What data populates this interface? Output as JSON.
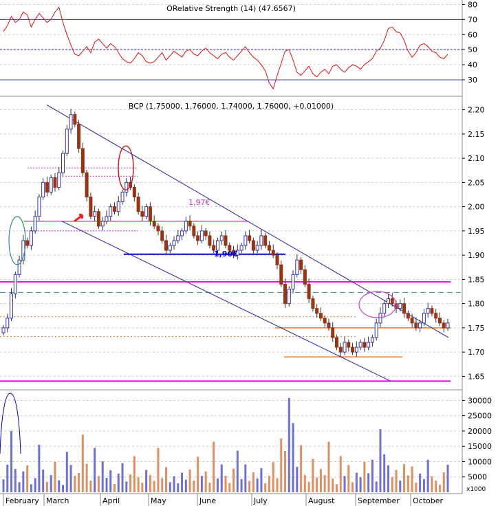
{
  "chart_data": [
    {
      "type": "line",
      "title": "ORelative Strength (14) (47.6567)",
      "ylim": [
        20,
        82
      ],
      "y_ticks": [
        "80",
        "70",
        "60",
        "50",
        "40",
        "30"
      ],
      "y_tick_values": [
        80,
        70,
        60,
        50,
        40,
        30
      ],
      "reference_lines": [
        70,
        50,
        30
      ],
      "grid": true,
      "series": [
        {
          "values": [
            62,
            66,
            72,
            68,
            70,
            75,
            73,
            65,
            70,
            74,
            71,
            68,
            70,
            75,
            78,
            68,
            60,
            53,
            47,
            46,
            49,
            52,
            48,
            55,
            57,
            54,
            51,
            54,
            52,
            48,
            44,
            42,
            41,
            44,
            48,
            46,
            42,
            41,
            42,
            45,
            48,
            43,
            46,
            49,
            47,
            45,
            49,
            50,
            47,
            46,
            49,
            51,
            48,
            46,
            44,
            47,
            48,
            45,
            43,
            46,
            49,
            52,
            48,
            45,
            43,
            40,
            36,
            28,
            24,
            33,
            41,
            49,
            50,
            43,
            35,
            33,
            36,
            39,
            34,
            32,
            35,
            37,
            34,
            39,
            40,
            37,
            35,
            38,
            40,
            39,
            37,
            40,
            42,
            44,
            49,
            51,
            56,
            64,
            65,
            62,
            61,
            56,
            49,
            45,
            48,
            53,
            54,
            52,
            49,
            48,
            45,
            44,
            47
          ]
        }
      ]
    },
    {
      "type": "candlestick",
      "title": "BCP (1.75000, 1.76000, 1.74000, 1.76000, +0.01000)",
      "ylim": [
        1.625,
        2.225
      ],
      "y_ticks": [
        "2.20",
        "2.15",
        "2.10",
        "2.05",
        "2.00",
        "1.95",
        "1.90",
        "1.85",
        "1.80",
        "1.75",
        "1.70",
        "1.65"
      ],
      "y_tick_values": [
        2.2,
        2.15,
        2.1,
        2.05,
        2.0,
        1.95,
        1.9,
        1.85,
        1.8,
        1.75,
        1.7,
        1.65
      ],
      "grid": true,
      "close": [
        1.75,
        1.77,
        1.82,
        1.86,
        1.89,
        1.93,
        1.92,
        1.95,
        1.98,
        2.02,
        2.05,
        2.03,
        2.06,
        2.04,
        2.07,
        2.11,
        2.16,
        2.19,
        2.17,
        2.12,
        2.07,
        2.02,
        1.98,
        1.99,
        1.96,
        1.97,
        1.98,
        2.0,
        1.99,
        2.01,
        2.03,
        2.05,
        2.04,
        2.02,
        1.99,
        1.98,
        2.0,
        1.97,
        1.96,
        1.95,
        1.93,
        1.91,
        1.92,
        1.93,
        1.94,
        1.95,
        1.97,
        1.96,
        1.94,
        1.93,
        1.95,
        1.94,
        1.92,
        1.91,
        1.93,
        1.94,
        1.92,
        1.91,
        1.9,
        1.91,
        1.92,
        1.94,
        1.93,
        1.91,
        1.92,
        1.94,
        1.92,
        1.91,
        1.9,
        1.88,
        1.84,
        1.8,
        1.83,
        1.86,
        1.89,
        1.87,
        1.84,
        1.81,
        1.79,
        1.78,
        1.77,
        1.76,
        1.75,
        1.73,
        1.71,
        1.7,
        1.72,
        1.71,
        1.7,
        1.71,
        1.72,
        1.71,
        1.72,
        1.73,
        1.76,
        1.78,
        1.8,
        1.81,
        1.8,
        1.79,
        1.8,
        1.78,
        1.77,
        1.76,
        1.75,
        1.76,
        1.78,
        1.79,
        1.78,
        1.77,
        1.76,
        1.75,
        1.76
      ],
      "x_labels": [
        "February",
        "March",
        "April",
        "May",
        "June",
        "July",
        "August",
        "September",
        "October"
      ],
      "annotations": {
        "price_label_1": "1,97€",
        "price_label_2": "1,90€"
      },
      "horizontal_levels": {
        "magenta_solid": [
          1.845,
          1.64
        ],
        "magenta_dashed": [
          2.08,
          1.95
        ],
        "magenta_short": [
          2.063,
          1.97
        ],
        "blue_solid": [
          1.902
        ],
        "teal_dashed": [
          1.823
        ],
        "orange_solid": [
          1.75,
          1.69
        ],
        "orange_dotted": [
          1.773,
          1.732
        ]
      },
      "channel_lines": [
        {
          "from": [
            0,
            2.21
          ],
          "to": [
            112,
            1.73
          ]
        },
        {
          "from": [
            0,
            1.97
          ],
          "to": [
            112,
            1.64
          ]
        }
      ],
      "highlights": {
        "teal_ellipse_center": [
          1.93
        ],
        "red_ellipse_center": [
          2.08
        ],
        "magenta_ellipse_center": [
          1.798
        ]
      }
    },
    {
      "type": "bar",
      "title": "",
      "ylim": [
        0,
        33000
      ],
      "y_ticks": [
        "30000",
        "25000",
        "20000",
        "15000",
        "10000",
        "5000"
      ],
      "y_tick_values": [
        30000,
        25000,
        20000,
        15000,
        10000,
        5000
      ],
      "unit_label": "x1000",
      "values": [
        4200,
        9000,
        20000,
        7600,
        3300,
        6800,
        8800,
        2600,
        4600,
        15500,
        7400,
        3400,
        5600,
        9900,
        3900,
        2400,
        13200,
        8900,
        5400,
        6300,
        18800,
        9300,
        3800,
        14500,
        5300,
        10100,
        4700,
        7200,
        2700,
        6100,
        9500,
        3500,
        5800,
        11800,
        4900,
        3100,
        7300,
        5600,
        3700,
        14500,
        4600,
        8200,
        3300,
        5200,
        2900,
        6400,
        4100,
        7400,
        3800,
        11600,
        5300,
        6800,
        3100,
        16500,
        4500,
        9100,
        5400,
        3000,
        7700,
        13600,
        4300,
        9100,
        3700,
        6500,
        4500,
        7900,
        2900,
        5400,
        9800,
        4600,
        17600,
        13500,
        30800,
        22600,
        8300,
        15400,
        5600,
        3400,
        10900,
        4800,
        7600,
        5600,
        16500,
        4500,
        2600,
        11800,
        5300,
        8900,
        3300,
        6400,
        4900,
        9900,
        6200,
        10600,
        3500,
        20600,
        12400,
        8800,
        4900,
        7300,
        3800,
        9200,
        5500,
        8400,
        3100,
        6100,
        4300,
        10600,
        5200,
        3800,
        2400,
        6500,
        9000
      ],
      "colors": [
        "#e09060",
        "#6f6fd8"
      ]
    }
  ]
}
